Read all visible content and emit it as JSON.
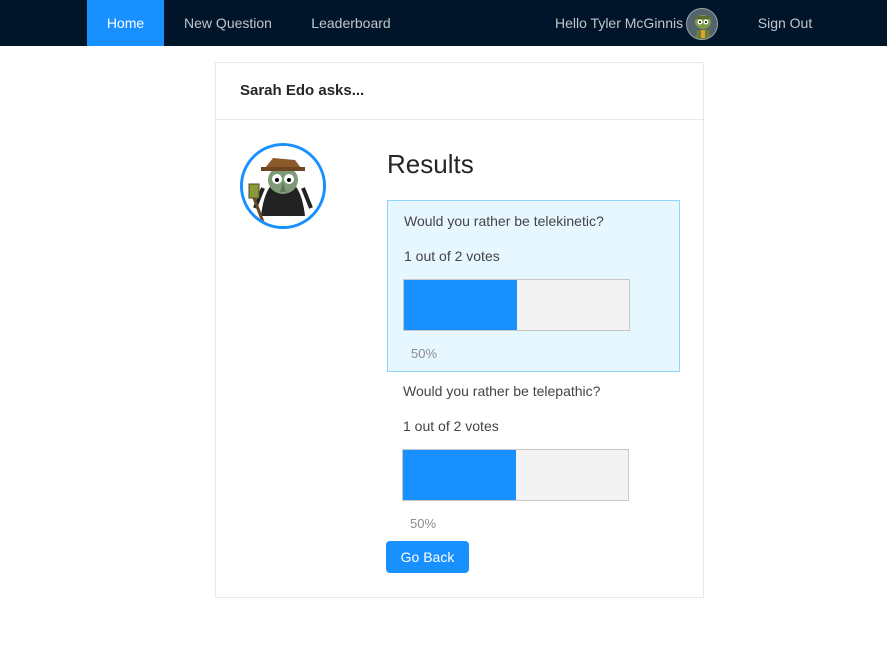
{
  "nav": {
    "home": "Home",
    "new_question": "New Question",
    "leaderboard": "Leaderboard",
    "greeting": "Hello Tyler McGinnis",
    "sign_out": "Sign Out"
  },
  "card": {
    "title": "Sarah Edo asks...",
    "results_heading": "Results",
    "options": [
      {
        "text": "Would you rather be telekinetic?",
        "votes_text": "1 out of 2 votes",
        "percent_text": "50%",
        "percent": 50,
        "selected": true
      },
      {
        "text": "Would you rather be telepathic?",
        "votes_text": "1 out of 2 votes",
        "percent_text": "50%",
        "percent": 50,
        "selected": false
      }
    ],
    "back_button": "Go Back"
  },
  "colors": {
    "nav_bg": "#001529",
    "accent": "#1890ff",
    "selected_bg": "#e6f7ff",
    "bar_track": "#f3f3f3"
  },
  "icons": {
    "user_avatar": "user-avatar-icon",
    "author_avatar": "author-avatar-icon"
  }
}
